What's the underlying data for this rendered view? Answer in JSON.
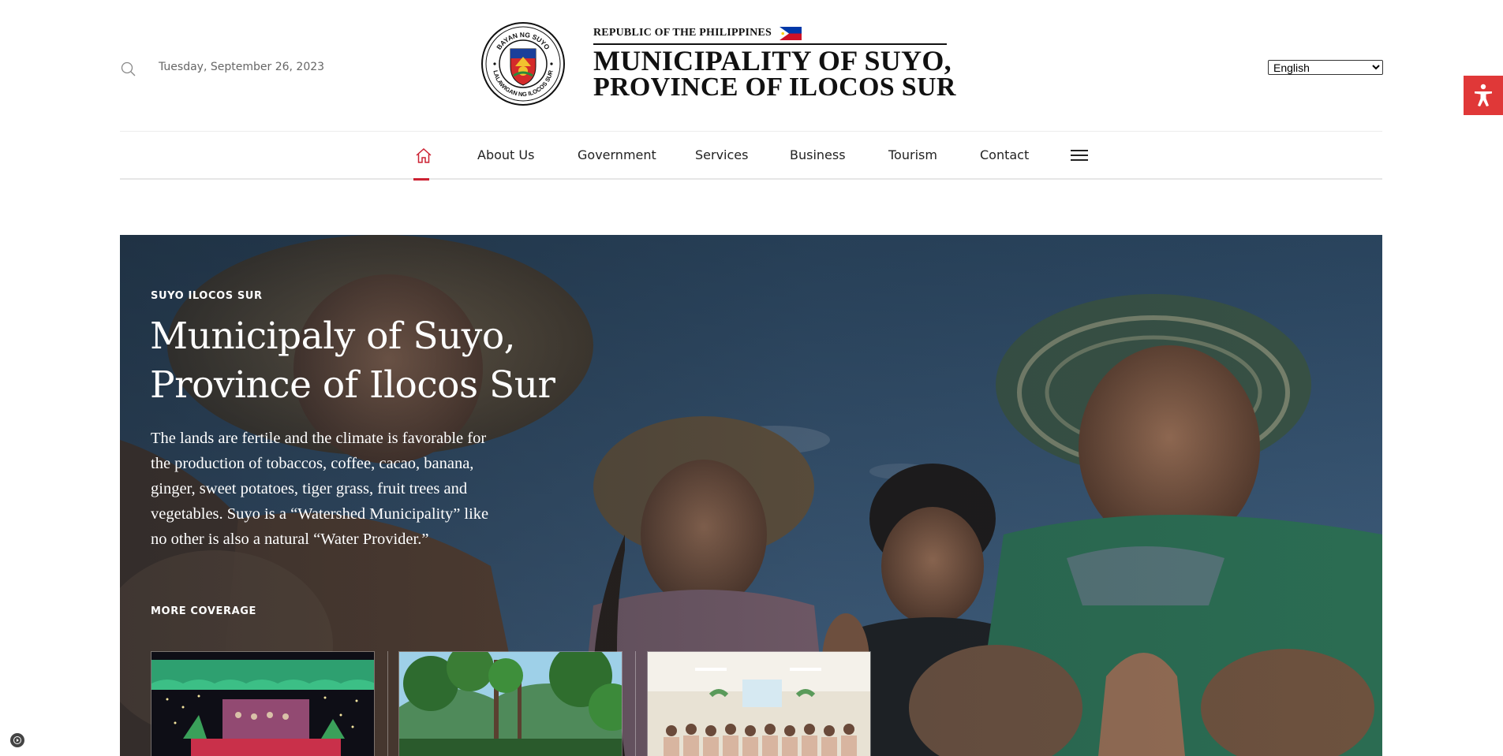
{
  "header": {
    "date": "Tuesday, September 26, 2023",
    "seal": {
      "top_text": "BAYAN NG SUYO",
      "bottom_text": "LALAWIGAN NG ILOCOS SUR"
    },
    "republic": "REPUBLIC OF THE PHILIPPINES",
    "municipality": "MUNICIPALITY OF SUYO,",
    "province": "PROVINCE OF ILOCOS SUR",
    "language": {
      "selected": "English"
    }
  },
  "nav": {
    "items": [
      {
        "label": "About Us"
      },
      {
        "label": "Government"
      },
      {
        "label": "Services"
      },
      {
        "label": "Business"
      },
      {
        "label": "Tourism"
      },
      {
        "label": "Contact"
      }
    ],
    "active": "home"
  },
  "hero": {
    "eyebrow": "SUYO ILOCOS SUR",
    "title": "Municipaly of Suyo, Province of Ilocos Sur",
    "description": "The lands are fertile and the climate is favorable for the production of tobaccos, coffee, cacao, banana, ginger, sweet potatoes, tiger grass, fruit trees and vegetables. Suyo is a “Watershed Municipality” like no other is also a natural “Water Provider.”",
    "more_label": "MORE COVERAGE"
  },
  "colors": {
    "accent": "#cc2233",
    "access_button": "#e03838",
    "hero_overlay": "#1e2a34"
  },
  "icons": {
    "search": "search-icon",
    "home": "home-icon",
    "menu": "hamburger-menu-icon",
    "accessibility": "accessibility-icon"
  }
}
